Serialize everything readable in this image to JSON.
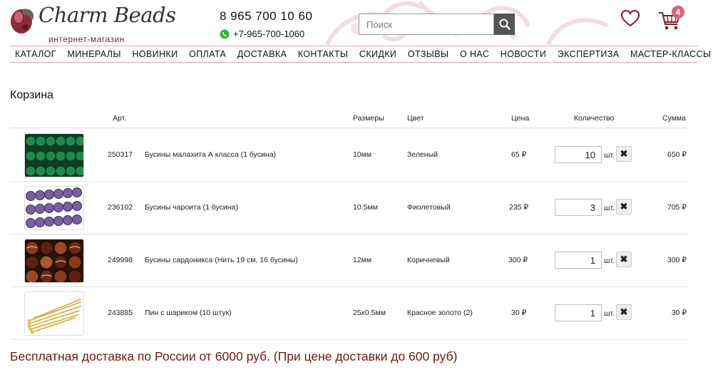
{
  "header": {
    "logo_title": "Charm Beads",
    "logo_subtitle": "интернет-магазин",
    "phone_main": "8 965 700 10 60",
    "phone_whatsapp": "+7-965-700-1060",
    "search_placeholder": "Поиск",
    "cart_count": "4",
    "icons": [
      "logo-emblem",
      "whatsapp-icon",
      "search-icon",
      "heart-icon",
      "cart-icon"
    ]
  },
  "nav": {
    "items": [
      "КАТАЛОГ",
      "МИНЕРАЛЫ",
      "НОВИНКИ",
      "ОПЛАТА",
      "ДОСТАВКА",
      "КОНТАКТЫ",
      "СКИДКИ",
      "ОТЗЫВЫ",
      "О НАС",
      "НОВОСТИ",
      "ЭКСПЕРТИЗА",
      "МАСТЕР-КЛАССЫ"
    ]
  },
  "cart": {
    "title": "Корзина",
    "columns": {
      "art": "Арт.",
      "size": "Размеры",
      "color": "Цвет",
      "price": "Цена",
      "qty": "Количество",
      "sum": "Сумма"
    },
    "unit_label": "шт.",
    "rows": [
      {
        "art": "250317",
        "name": "Бусины малахита А класса (1 бусина)",
        "size": "10мм",
        "color": "Зеленый",
        "price": "65 ₽",
        "qty": "10",
        "sum": "650 ₽",
        "thumb": "malachite"
      },
      {
        "art": "236102",
        "name": "Бусины чароита (1 бусина)",
        "size": "10.5мм",
        "color": "Фиолетовый",
        "price": "235 ₽",
        "qty": "3",
        "sum": "705 ₽",
        "thumb": "charoite"
      },
      {
        "art": "249998",
        "name": "Бусины сардоникса (Нить 19 см, 16 бусины)",
        "size": "12мм",
        "color": "Коричневый",
        "price": "300 ₽",
        "qty": "1",
        "sum": "300 ₽",
        "thumb": "sardonyx"
      },
      {
        "art": "243885",
        "name": "Пин с шариком (10 штук)",
        "size": "25х0.5мм",
        "color": "Красное золото (2)",
        "price": "30 ₽",
        "qty": "1",
        "sum": "30 ₽",
        "thumb": "gold-pins"
      }
    ],
    "free_shipping": "Бесплатная доставка по России от 6000 руб. (При цене доставки до 600 руб)"
  },
  "colors": {
    "accent": "#d2667a",
    "nav_border": "#d9aab3",
    "shipping_text": "#6e1a14"
  }
}
